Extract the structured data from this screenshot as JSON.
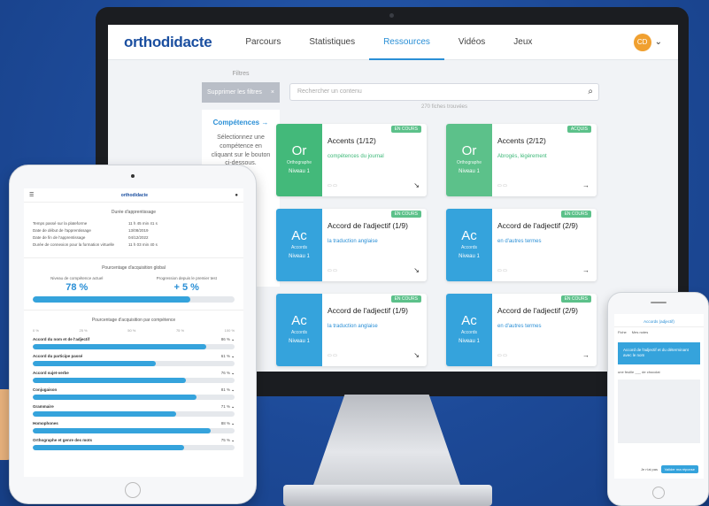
{
  "desktop": {
    "logo": "orthodidacte",
    "nav": [
      "Parcours",
      "Statistiques",
      "Ressources",
      "Vidéos",
      "Jeux"
    ],
    "active_nav": "Ressources",
    "avatar": "CD",
    "filters_label": "Filtres",
    "filter_pill": "Supprimer les filtres",
    "competences_title": "Compétences →",
    "competences_desc": "Sélectionnez une compétence en cliquant sur le bouton ci-dessous.",
    "search_placeholder": "Rechercher un contenu",
    "results_count": "270 fiches trouvées",
    "cards": [
      {
        "abbr": "Or",
        "cat": "Orthographe",
        "level": "Niveau 1",
        "title": "Accents (1/12)",
        "sub": "compétences du journal",
        "badge": "EN COURS",
        "color": "#43b97a"
      },
      {
        "abbr": "Or",
        "cat": "Orthographe",
        "level": "Niveau 1",
        "title": "Accents (2/12)",
        "sub": "Abrogés, légèrement",
        "badge": "ACQUIS",
        "color": "#5cc18a"
      },
      {
        "abbr": "Ac",
        "cat": "Accords",
        "level": "Niveau 1",
        "title": "Accord de l'adjectif (1/9)",
        "sub": "la traduction anglaise",
        "badge": "EN COURS",
        "color": "#35a3dc"
      },
      {
        "abbr": "Ac",
        "cat": "Accords",
        "level": "Niveau 1",
        "title": "Accord de l'adjectif (2/9)",
        "sub": "en d'autres termes",
        "badge": "EN COURS",
        "color": "#35a3dc"
      },
      {
        "abbr": "Ac",
        "cat": "Accords",
        "level": "Niveau 1",
        "title": "Accord de l'adjectif (1/9)",
        "sub": "la traduction anglaise",
        "badge": "EN COURS",
        "color": "#35a3dc"
      },
      {
        "abbr": "Ac",
        "cat": "Accords",
        "level": "Niveau 1",
        "title": "Accord de l'adjectif (2/9)",
        "sub": "en d'autres termes",
        "badge": "EN COURS",
        "color": "#35a3dc"
      }
    ]
  },
  "tablet": {
    "logo": "orthodidacte",
    "section1": "Durée d'apprentissage",
    "stats": [
      {
        "label": "Temps passé sur la plateforme",
        "value": "11 h 45 min 41 s"
      },
      {
        "label": "Date de début de l'apprentissage",
        "value": "13/08/2019"
      },
      {
        "label": "Date de fin de l'apprentissage",
        "value": "04/12/2022"
      },
      {
        "label": "Durée de connexion pour la formation virtuelle",
        "value": "11 h 03 min 40 s"
      }
    ],
    "section2": "Pourcentage d'acquisition global",
    "big_left_label": "Niveau de compétence actuel",
    "big_left_value": "78 %",
    "big_right_label": "Progression depuis le premier test",
    "big_right_value": "+ 5 %",
    "global_fill": 0.78,
    "section3": "Pourcentage d'acquisition par compétence",
    "axis": [
      "0 %",
      "25 %",
      "50 %",
      "75 %",
      "100 %"
    ],
    "competences": [
      {
        "name": "Accord du nom et de l'adjectif",
        "pct": "86 %",
        "fill": 0.86
      },
      {
        "name": "Accord du participe passé",
        "pct": "61 %",
        "fill": 0.61
      },
      {
        "name": "Accord sujet-verbe",
        "pct": "76 %",
        "fill": 0.76
      },
      {
        "name": "Conjugaison",
        "pct": "81 %",
        "fill": 0.81
      },
      {
        "name": "Grammaire",
        "pct": "71 %",
        "fill": 0.71
      },
      {
        "name": "Homophones",
        "pct": "88 %",
        "fill": 0.88
      },
      {
        "name": "Orthographe et genre des mots",
        "pct": "75 %",
        "fill": 0.75
      }
    ]
  },
  "phone": {
    "header": "Accords (adjectif)",
    "tabs": [
      "Fiche",
      "Mes notes"
    ],
    "card_text": "Accord de l'adjectif et du déterminant avec le nom",
    "input_text": "une feuille ___ de chocolat",
    "action_button": "Valider ma réponse",
    "back_label": "Je n'ai pas"
  }
}
